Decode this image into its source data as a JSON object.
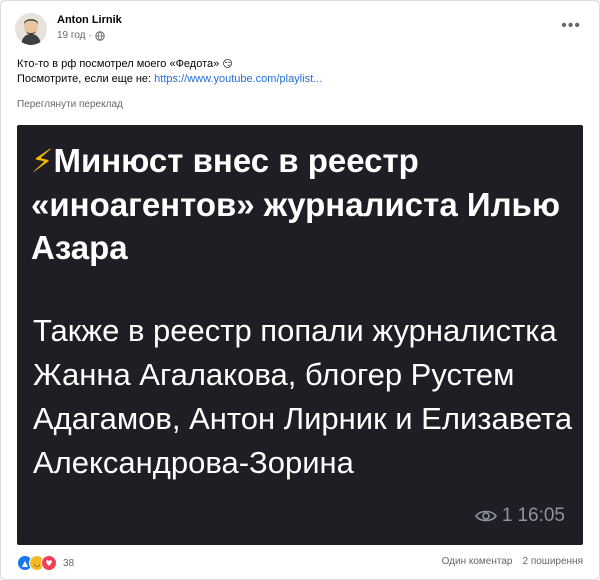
{
  "post": {
    "author": "Anton Lirnik",
    "time": "19 год",
    "line1": "Кто-то в рф посмотрел моего «Федота»",
    "line1_emoji": "😏",
    "line2_prefix": "Посмотрите, если еще не: ",
    "link_text": "https://www.youtube.com/playlist...",
    "translate": "Переглянути переклад"
  },
  "media": {
    "lightning": "⚡",
    "headline": "Минюст внес в реестр «иноагентов» журналиста Илью Азара",
    "body": "Также в реестр попали журналистка Жанна Агалакова, блогер Рустем Адагамов, Антон Лирник и Елизавета Александрова-Зорина",
    "views": "1",
    "time": "16:05"
  },
  "footer": {
    "reaction_count": "38",
    "comments": "Один коментар",
    "shares": "2 поширення"
  },
  "icons": {
    "reactions": [
      "like-icon",
      "haha-icon",
      "love-icon"
    ],
    "header": [
      "globe-icon",
      "more-icon"
    ],
    "media": [
      "eye-icon"
    ]
  },
  "colors": {
    "link": "#216fdb",
    "media_background": "#1e1e24",
    "lightning": "#f5b800"
  }
}
